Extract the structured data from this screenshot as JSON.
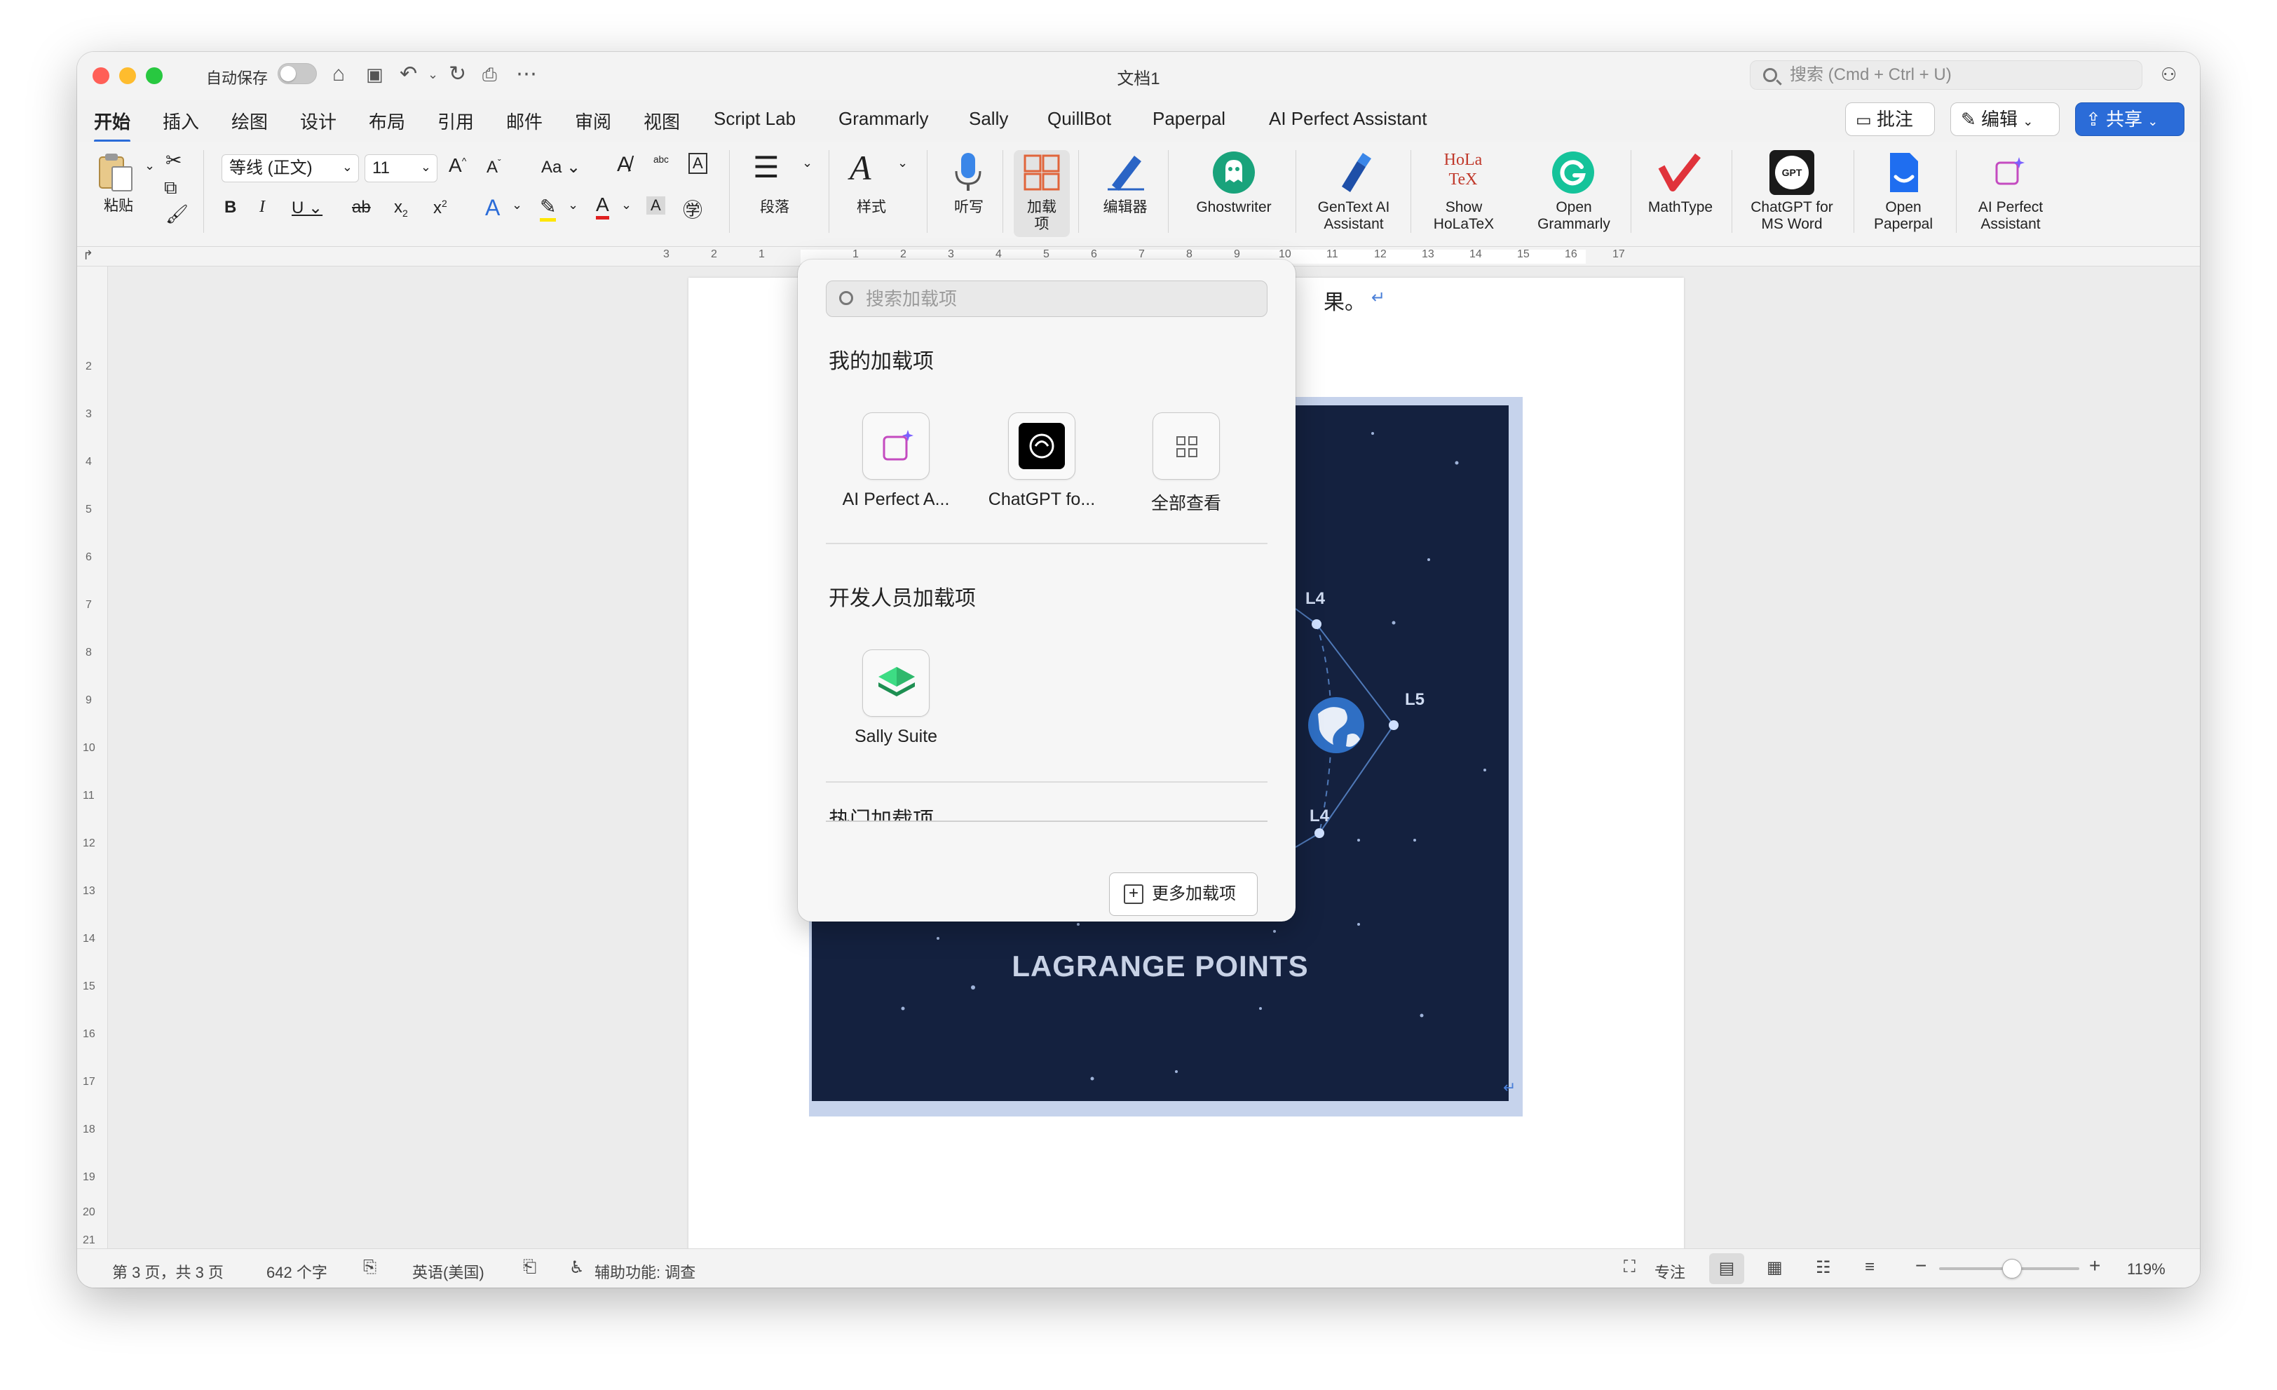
{
  "titlebar": {
    "autosave_label": "自动保存",
    "doc_title": "文档1",
    "search_placeholder": "搜索 (Cmd + Ctrl + U)"
  },
  "tabs": [
    "开始",
    "插入",
    "绘图",
    "设计",
    "布局",
    "引用",
    "邮件",
    "审阅",
    "视图",
    "Script Lab",
    "Grammarly",
    "Sally",
    "QuillBot",
    "Paperpal",
    "AI Perfect Assistant"
  ],
  "top_buttons": {
    "comment": "批注",
    "edit": "编辑",
    "share": "共享"
  },
  "ribbon": {
    "paste": "粘贴",
    "font_name": "等线 (正文)",
    "font_size": "11",
    "paragraph": "段落",
    "styles": "样式",
    "dictate": "听写",
    "addins_line1": "加载",
    "addins_line2": "项",
    "editor": "编辑器",
    "ghostwriter": "Ghostwriter",
    "gentext_1": "GenText AI",
    "gentext_2": "Assistant",
    "holatex_1": "Show",
    "holatex_2": "HoLaTeX",
    "grammarly_1": "Open",
    "grammarly_2": "Grammarly",
    "mathtype": "MathType",
    "chatgpt_1": "ChatGPT for",
    "chatgpt_2": "MS Word",
    "paperpal_1": "Open",
    "paperpal_2": "Paperpal",
    "aiperfect_1": "AI Perfect",
    "aiperfect_2": "Assistant",
    "holatex_logo": "HoLa TeX",
    "chatgpt_logo": "GPT"
  },
  "ruler_h": [
    "3",
    "2",
    "1",
    "1",
    "2",
    "3",
    "4",
    "5",
    "6",
    "7",
    "8",
    "9",
    "10",
    "11",
    "12",
    "13",
    "14",
    "15",
    "16",
    "17"
  ],
  "ruler_v": [
    "2",
    "3",
    "4",
    "5",
    "6",
    "7",
    "8",
    "9",
    "10",
    "11",
    "12",
    "13",
    "14",
    "15",
    "16",
    "17",
    "18",
    "19",
    "20",
    "21"
  ],
  "document": {
    "text_fragment": "果。",
    "figure": {
      "title": "LAGRANGE POINTS",
      "labels": [
        "L4",
        "L5",
        "L4"
      ]
    }
  },
  "addins_popover": {
    "search_placeholder": "搜索加载项",
    "my_addins_heading": "我的加载项",
    "my_addins": [
      {
        "label": "AI Perfect A...",
        "icon": "ai-perfect-icon"
      },
      {
        "label": "ChatGPT fo...",
        "icon": "chatgpt-icon"
      },
      {
        "label": "全部查看",
        "icon": "grid-icon"
      }
    ],
    "dev_addins_heading": "开发人员加载项",
    "dev_addins": [
      {
        "label": "Sally Suite",
        "icon": "sally-suite-icon"
      }
    ],
    "popular_heading": "热门加载项",
    "more_button": "更多加载项"
  },
  "statusbar": {
    "page": "第 3 页，共 3 页",
    "words": "642 个字",
    "language": "英语(美国)",
    "accessibility": "辅助功能: 调查",
    "focus": "专注",
    "zoom": "119%",
    "zoom_level_percent": 119
  },
  "colors": {
    "accent": "#2b6cd8",
    "space_bg": "#14213f",
    "close": "#ff5f57",
    "minimize": "#febc2e",
    "zoom": "#28c840"
  }
}
